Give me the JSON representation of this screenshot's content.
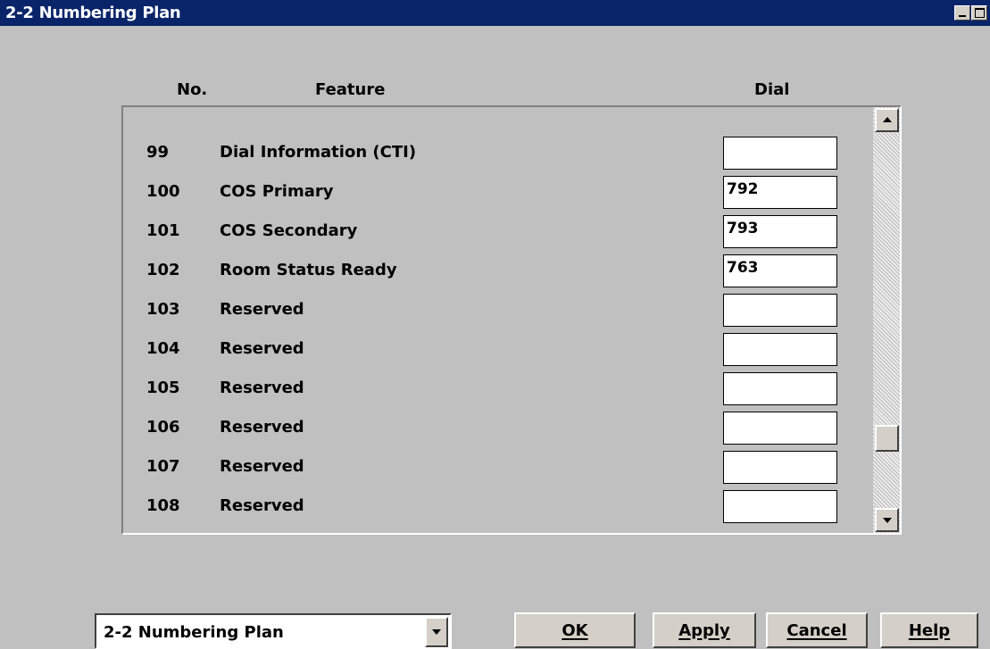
{
  "window": {
    "title": "2-2 Numbering Plan"
  },
  "columns": {
    "no": "No.",
    "feature": "Feature",
    "dial": "Dial"
  },
  "rows": [
    {
      "no": "99",
      "feature": "Dial Information (CTI)",
      "dial": ""
    },
    {
      "no": "100",
      "feature": "COS Primary",
      "dial": "792"
    },
    {
      "no": "101",
      "feature": "COS Secondary",
      "dial": "793"
    },
    {
      "no": "102",
      "feature": "Room Status Ready",
      "dial": "763"
    },
    {
      "no": "103",
      "feature": "Reserved",
      "dial": ""
    },
    {
      "no": "104",
      "feature": "Reserved",
      "dial": ""
    },
    {
      "no": "105",
      "feature": "Reserved",
      "dial": ""
    },
    {
      "no": "106",
      "feature": "Reserved",
      "dial": ""
    },
    {
      "no": "107",
      "feature": "Reserved",
      "dial": ""
    },
    {
      "no": "108",
      "feature": "Reserved",
      "dial": ""
    }
  ],
  "scroll_position": 0.84,
  "footer": {
    "page_select": "2-2 Numbering Plan",
    "buttons": {
      "ok": "OK",
      "apply": "Apply",
      "cancel": "Cancel",
      "help": "Help"
    }
  },
  "icons": {
    "minimize": "minimize-icon",
    "maximize": "maximize-icon",
    "scroll_up": "arrow-up-icon",
    "scroll_down": "arrow-down-icon",
    "dropdown": "chevron-down-icon"
  },
  "colors": {
    "titlebar": "#0a246a",
    "face": "#c0c0c0",
    "field": "#ffffff"
  }
}
